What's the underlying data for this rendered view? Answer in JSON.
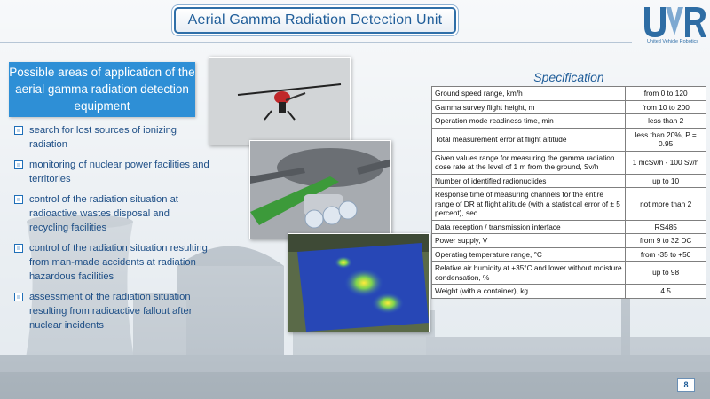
{
  "slide": {
    "title": "Aerial Gamma Radiation Detection Unit",
    "page_number": "8"
  },
  "logo": {
    "mark": "UVR",
    "subtitle": "United Vehicle Robotics"
  },
  "applications": {
    "heading": "Possible areas of application of the aerial gamma radiation detection equipment",
    "items": [
      "search for lost sources of ionizing radiation",
      "monitoring of nuclear power facilities and territories",
      "control of the radiation situation at radioactive wastes disposal and recycling facilities",
      "control of the radiation situation resulting from man-made accidents at radiation hazardous facilities",
      "assessment of the radiation situation resulting from radioactive fallout after nuclear incidents"
    ]
  },
  "specification": {
    "title": "Specification",
    "rows": [
      {
        "param": "Ground speed range, km/h",
        "value": "from 0 to 120"
      },
      {
        "param": "Gamma survey flight height, m",
        "value": "from 10 to 200"
      },
      {
        "param": "Operation mode readiness time, min",
        "value": "less than 2"
      },
      {
        "param": "Total measurement error at flight altitude",
        "value": "less than 20%, P = 0.95"
      },
      {
        "param": "Given values range for measuring the gamma radiation dose rate at the level of 1 m from the ground, Sv/h",
        "value": "1 mcSv/h - 100 Sv/h"
      },
      {
        "param": "Number of identified radionuclides",
        "value": "up to 10"
      },
      {
        "param": "Response time of measuring channels for the entire range of DR at flight altitude (with a statistical error of ± 5 percent), sec.",
        "value": "not more than 2"
      },
      {
        "param": "Data reception / transmission interface",
        "value": "RS485"
      },
      {
        "param": "Power supply, V",
        "value": "from 9 to 32 DC"
      },
      {
        "param": "Operating temperature range, °C",
        "value": "from -35 to +50"
      },
      {
        "param": "Relative air humidity at +35°C and lower without moisture condensation, %",
        "value": "up to 98"
      },
      {
        "param": "Weight (with a container), kg",
        "value": "4.5"
      }
    ]
  },
  "images": {
    "helicopter_photo": "helicopter-drone-image",
    "detector_render": "detector-mount-render-image",
    "radiation_map": "radiation-heatmap-image"
  }
}
